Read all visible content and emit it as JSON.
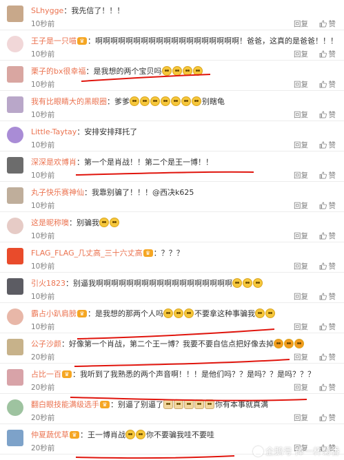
{
  "actions": {
    "reply_label": "回复",
    "like_label": "赞"
  },
  "annotation_color": "#e0140c",
  "watermark": {
    "text": "企鹅号 捧一杯菊香"
  },
  "comments": [
    {
      "user": "SLhygge",
      "vip": false,
      "segments": [
        {
          "t": "我先信了！！！"
        }
      ],
      "time": "10秒前"
    },
    {
      "user": "王子是一只喵",
      "vip": true,
      "segments": [
        {
          "t": "啊啊啊啊啊啊啊啊啊啊啊啊啊啊啊啊啊啊啊！爸爸，这真的是爸爸！！！！！"
        }
      ],
      "time": "10秒前"
    },
    {
      "user": "栗子的bx很幸福",
      "vip": false,
      "segments": [
        {
          "t": "是我想的两个宝贝吗"
        },
        {
          "e": "cry",
          "n": 4
        }
      ],
      "time": "10秒前"
    },
    {
      "user": "我有比眼睛大的黑眼圈",
      "vip": false,
      "segments": [
        {
          "t": "爹爹"
        },
        {
          "e": "cry",
          "n": 7
        },
        {
          "t": "别瞎龟"
        }
      ],
      "time": "10秒前"
    },
    {
      "user": "Little-Taytay",
      "vip": false,
      "segments": [
        {
          "t": "安排安排拜托了"
        }
      ],
      "time": "10秒前"
    },
    {
      "user": "深深是欢博肖",
      "vip": false,
      "segments": [
        {
          "t": "第一个是肖战！！第二个是王一博！！"
        }
      ],
      "time": "10秒前"
    },
    {
      "user": "丸子快乐赛神仙",
      "vip": false,
      "segments": [
        {
          "t": "我靠别骗了！！！@西决k625"
        }
      ],
      "time": "10秒前"
    },
    {
      "user": "这是昵称噢",
      "vip": false,
      "segments": [
        {
          "t": "别骗我"
        },
        {
          "e": "cry",
          "n": 2
        }
      ],
      "time": "10秒前"
    },
    {
      "user": "FLAG_FLAG_几丈高_三十六丈高",
      "vip": true,
      "segments": [
        {
          "t": "？？？"
        }
      ],
      "time": "10秒前"
    },
    {
      "user": "引火1823",
      "vip": false,
      "segments": [
        {
          "t": "别逼我啊啊啊啊啊啊啊啊啊啊啊啊啊啊啊啊啊啊"
        },
        {
          "e": "cry",
          "n": 3
        }
      ],
      "time": "10秒前"
    },
    {
      "user": "霸占小趴肩膀",
      "vip": true,
      "segments": [
        {
          "t": "是我想的那两个人吗"
        },
        {
          "e": "cry",
          "n": 3
        },
        {
          "t": "不要拿这种事骗我"
        },
        {
          "e": "cry",
          "n": 2
        }
      ],
      "time": "10秒前"
    },
    {
      "user": "公子沙颜",
      "vip": false,
      "segments": [
        {
          "t": "好像第一个肖战，第二个王一博？我要不要自信点把好像去掉"
        },
        {
          "e": "grin",
          "n": 3
        }
      ],
      "time": "20秒前"
    },
    {
      "user": "占比一百",
      "vip": true,
      "segments": [
        {
          "t": "我听到了我熟悉的两个声音啊！！！是他们吗？？是吗？？是吗？？？"
        }
      ],
      "time": "20秒前"
    },
    {
      "user": "翻白眼技能满级选手",
      "vip": true,
      "segments": [
        {
          "t": "别逼了别逼了"
        },
        {
          "e": "cat",
          "n": 5
        },
        {
          "t": "你有本事就真满"
        }
      ],
      "time": "20秒前"
    },
    {
      "user": "仲夏蔬优草",
      "vip": true,
      "segments": [
        {
          "t": "王一博肖战"
        },
        {
          "e": "cry",
          "n": 2
        },
        {
          "t": "你不要骗我哇不要哇"
        }
      ],
      "time": "20秒前"
    }
  ]
}
